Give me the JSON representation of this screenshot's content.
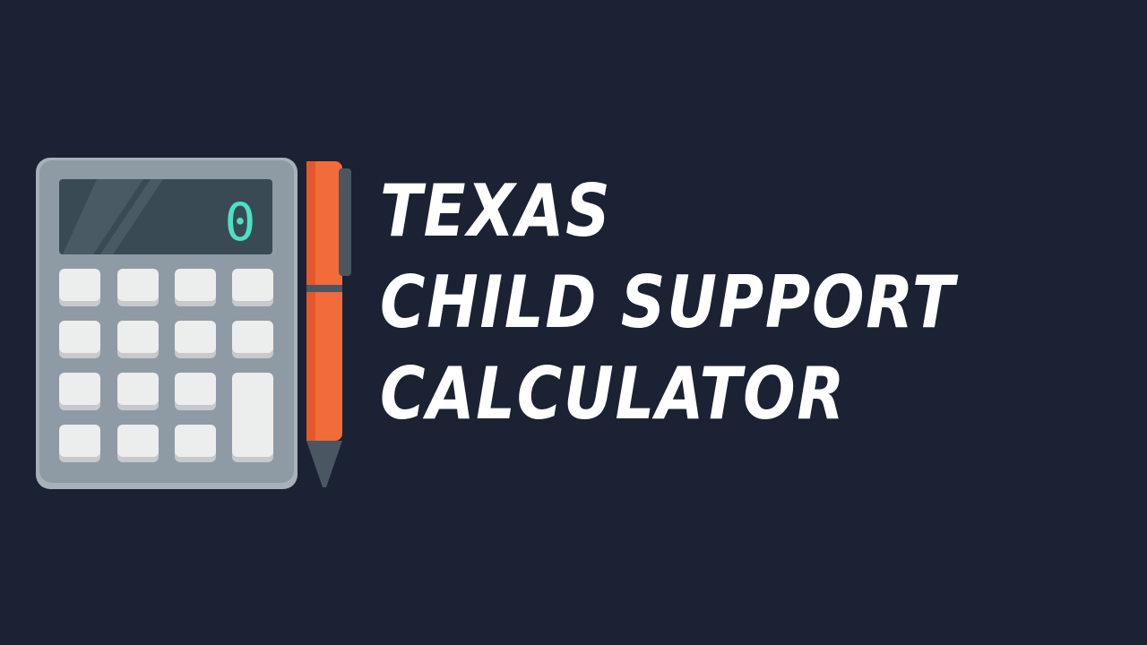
{
  "illustration": {
    "display_value": "0",
    "display_color": "#4de0c4",
    "pen_color": "#f26b3a",
    "calculator_color": "#8e9ba5"
  },
  "title": {
    "line1": "TEXAS",
    "line2": "CHILD SUPPORT",
    "line3": "CALCULATOR"
  }
}
